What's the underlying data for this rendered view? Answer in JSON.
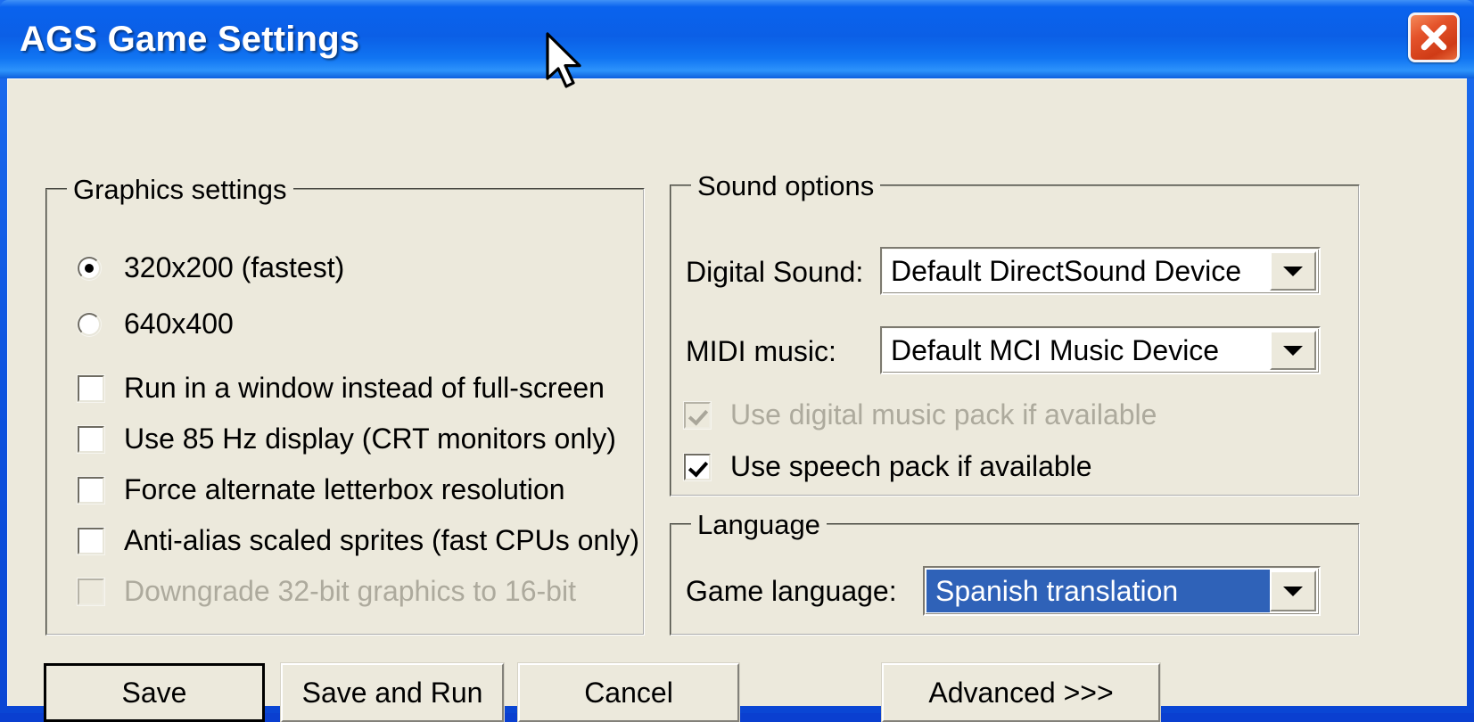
{
  "window": {
    "title": "AGS Game Settings",
    "close_icon": "close-icon",
    "accent_title_blue": "#0b5fe6",
    "client_bg": "#ece9dc",
    "selection_blue": "#2f62b8",
    "close_red": "#cf3b16"
  },
  "graphics": {
    "group_title": "Graphics settings",
    "resolutions": [
      {
        "label": "320x200  (fastest)",
        "checked": true,
        "disabled": false
      },
      {
        "label": "640x400",
        "checked": false,
        "disabled": false
      }
    ],
    "checkboxes": [
      {
        "label": "Run in a window instead of full-screen",
        "checked": false,
        "disabled": false
      },
      {
        "label": "Use 85 Hz display (CRT monitors only)",
        "checked": false,
        "disabled": false
      },
      {
        "label": "Force alternate letterbox resolution",
        "checked": false,
        "disabled": false
      },
      {
        "label": "Anti-alias scaled sprites (fast CPUs only)",
        "checked": false,
        "disabled": false
      },
      {
        "label": "Downgrade 32-bit graphics to 16-bit",
        "checked": false,
        "disabled": true
      }
    ]
  },
  "sound": {
    "group_title": "Sound options",
    "digital_label": "Digital Sound:",
    "digital_value": "Default DirectSound Device",
    "midi_label": "MIDI music:",
    "midi_value": "Default MCI Music Device",
    "checkboxes": [
      {
        "label": "Use digital music pack if available",
        "checked": true,
        "disabled": true
      },
      {
        "label": "Use speech pack if available",
        "checked": true,
        "disabled": false
      }
    ]
  },
  "language": {
    "group_title": "Language",
    "field_label": "Game language:",
    "value": "Spanish translation",
    "selected": true
  },
  "buttons": {
    "save": "Save",
    "save_and_run": "Save and Run",
    "cancel": "Cancel",
    "advanced": "Advanced  >>>"
  }
}
